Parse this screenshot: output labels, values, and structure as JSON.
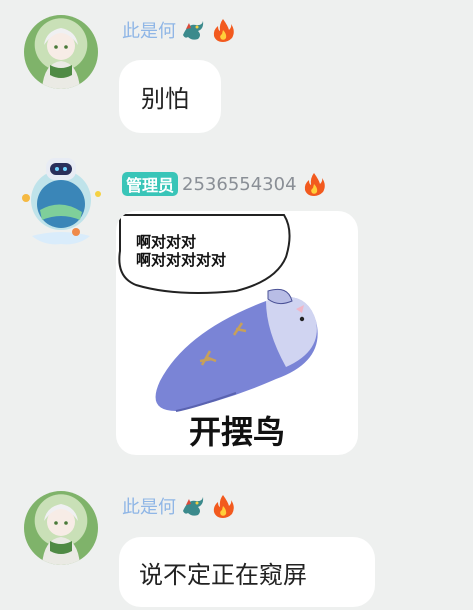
{
  "messages": [
    {
      "sender": "此是何",
      "text": "别怕"
    },
    {
      "role_badge": "管理员",
      "sender_id": "2536554304",
      "sticker": {
        "speech_line1": "啊对对对",
        "speech_line2": "啊对对对对对",
        "caption": "开摆鸟"
      }
    },
    {
      "sender": "此是何",
      "text": "说不定正在窥屏"
    }
  ],
  "colors": {
    "background": "#eef0ef",
    "nickname": "#8fb6e6",
    "badge": "#39c5b8",
    "fire": "#f25a1e"
  },
  "icons": [
    "dragon-icon",
    "fire-icon"
  ]
}
